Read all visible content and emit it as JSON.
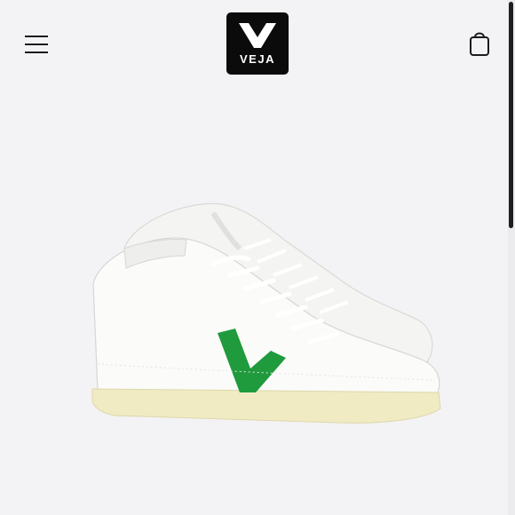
{
  "header": {
    "menu_icon": "hamburger-menu-icon",
    "logo_text": "VEJA",
    "logo_icon": "veja-v-logo-icon",
    "cart_icon": "shopping-bag-icon"
  },
  "product": {
    "image_icon": "high-top-sneaker-image"
  },
  "colors": {
    "background": "#f3f3f5",
    "logo_bg": "#0b0b0b",
    "accent_green": "#1f9a3c",
    "sole_cream": "#f1ebc4",
    "text_dark": "#1a1a1a"
  }
}
